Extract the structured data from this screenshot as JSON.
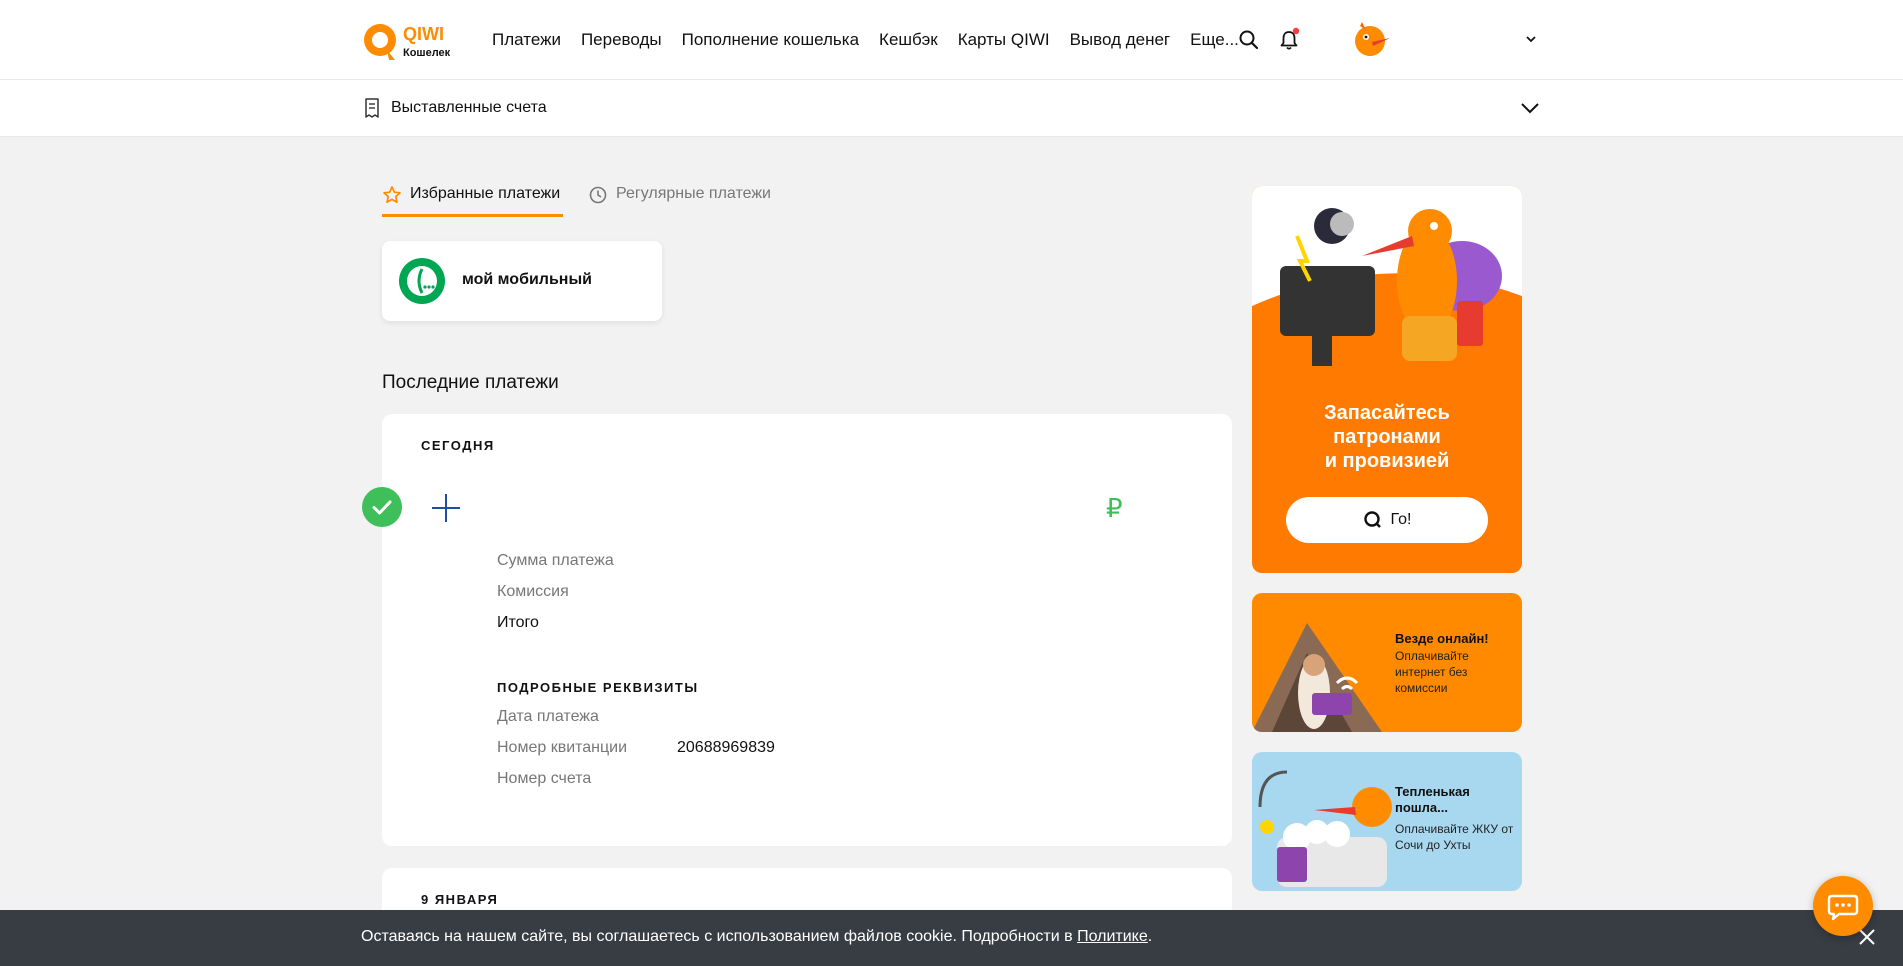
{
  "header": {
    "logo_text": "QIWI",
    "logo_sub": "Кошелек",
    "nav": [
      "Платежи",
      "Переводы",
      "Пополнение кошелька",
      "Кешбэк",
      "Карты QIWI",
      "Вывод денег",
      "Еще..."
    ]
  },
  "subbar": {
    "title": "Выставленные счета"
  },
  "tabs": [
    {
      "label": "Избранные платежи",
      "active": true
    },
    {
      "label": "Регулярные платежи",
      "active": false
    }
  ],
  "favorites": [
    {
      "label": "мой мобильный"
    }
  ],
  "recent": {
    "title": "Последние платежи",
    "groups": [
      {
        "day": "СЕГОДНЯ",
        "currency": "₽",
        "rows": {
          "amount": "Сумма платежа",
          "fee": "Комиссия",
          "total": "Итого"
        },
        "details_title": "ПОДРОБНЫЕ РЕКВИЗИТЫ",
        "details": [
          {
            "label": "Дата платежа",
            "value": ""
          },
          {
            "label": "Номер квитанции",
            "value": "20688969839"
          },
          {
            "label": "Номер счета",
            "value": ""
          }
        ]
      },
      {
        "day": "9 ЯНВАРЯ"
      }
    ]
  },
  "banners": {
    "main": {
      "title_lines": [
        "Запасайтесь",
        "патронами",
        "и провизией"
      ],
      "button": "Го!"
    },
    "b2": {
      "title": "Везде онлайн!",
      "sub": "Оплачивайте интернет без комиссии"
    },
    "b3": {
      "title": "Тепленькая пошла...",
      "sub": "Оплачивайте ЖКУ от Сочи до Ухты"
    }
  },
  "cookie": {
    "text": "Оставаясь на нашем сайте, вы соглашаетесь с использованием файлов cookie. Подробности в ",
    "link": "Политике",
    "end": "."
  },
  "colors": {
    "accent": "#ff8c00",
    "success": "#3fbf5a",
    "cookie_bg": "#383c43"
  }
}
